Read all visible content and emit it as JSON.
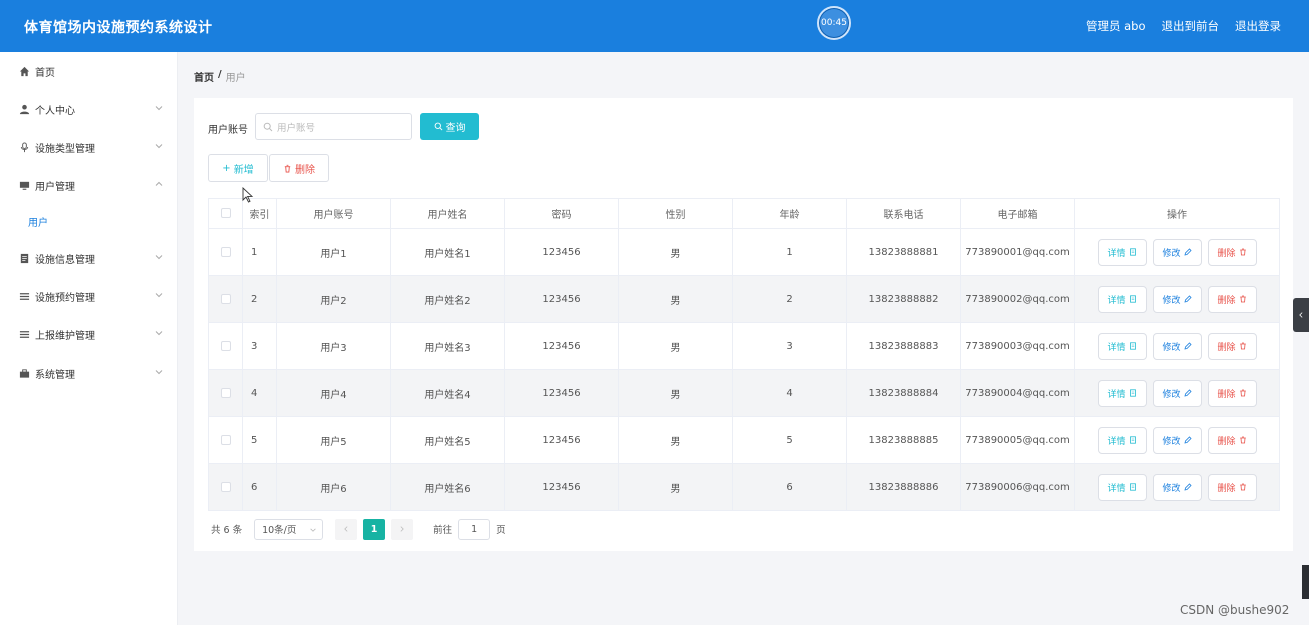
{
  "header": {
    "title": "体育馆场内设施预约系统设计",
    "timer": "00:45",
    "admin_label": "管理员 abo",
    "back_frontend": "退出到前台",
    "logout": "退出登录"
  },
  "sidebar": {
    "items": [
      {
        "label": "首页",
        "icon": "home-icon"
      },
      {
        "label": "个人中心",
        "icon": "user-icon"
      },
      {
        "label": "设施类型管理",
        "icon": "microphone-icon"
      },
      {
        "label": "用户管理",
        "icon": "monitor-icon"
      },
      {
        "label": "设施信息管理",
        "icon": "document-icon"
      },
      {
        "label": "设施预约管理",
        "icon": "list-icon"
      },
      {
        "label": "上报维护管理",
        "icon": "list-icon"
      },
      {
        "label": "系统管理",
        "icon": "briefcase-icon"
      }
    ],
    "sub_active": "用户"
  },
  "breadcrumb": {
    "home": "首页",
    "separator": "/",
    "current": "用户"
  },
  "search": {
    "label": "用户账号",
    "placeholder": "用户账号",
    "query_button": "查询"
  },
  "toolbar": {
    "add_label": "新增",
    "delete_label": "删除"
  },
  "table": {
    "headers": [
      "索引",
      "用户账号",
      "用户姓名",
      "密码",
      "性别",
      "年龄",
      "联系电话",
      "电子邮箱",
      "操作"
    ],
    "rows": [
      {
        "index": "1",
        "account": "用户1",
        "name": "用户姓名1",
        "password": "123456",
        "gender": "男",
        "age": "1",
        "phone": "13823888881",
        "email": "773890001@qq.com"
      },
      {
        "index": "2",
        "account": "用户2",
        "name": "用户姓名2",
        "password": "123456",
        "gender": "男",
        "age": "2",
        "phone": "13823888882",
        "email": "773890002@qq.com"
      },
      {
        "index": "3",
        "account": "用户3",
        "name": "用户姓名3",
        "password": "123456",
        "gender": "男",
        "age": "3",
        "phone": "13823888883",
        "email": "773890003@qq.com"
      },
      {
        "index": "4",
        "account": "用户4",
        "name": "用户姓名4",
        "password": "123456",
        "gender": "男",
        "age": "4",
        "phone": "13823888884",
        "email": "773890004@qq.com"
      },
      {
        "index": "5",
        "account": "用户5",
        "name": "用户姓名5",
        "password": "123456",
        "gender": "男",
        "age": "5",
        "phone": "13823888885",
        "email": "773890005@qq.com"
      },
      {
        "index": "6",
        "account": "用户6",
        "name": "用户姓名6",
        "password": "123456",
        "gender": "男",
        "age": "6",
        "phone": "13823888886",
        "email": "773890006@qq.com"
      }
    ],
    "row_actions": {
      "detail": "详情",
      "edit": "修改",
      "delete": "删除"
    }
  },
  "pagination": {
    "total": "共 6 条",
    "page_size": "10条/页",
    "current_page": "1",
    "goto_label": "前往",
    "goto_value": "1",
    "page_suffix": "页"
  },
  "watermark": "CSDN @bushe902",
  "colors": {
    "header_bg": "#1a7fde",
    "accent_cyan": "#22bcd1",
    "danger": "#e8524a",
    "pager_active": "#17b3a3"
  }
}
